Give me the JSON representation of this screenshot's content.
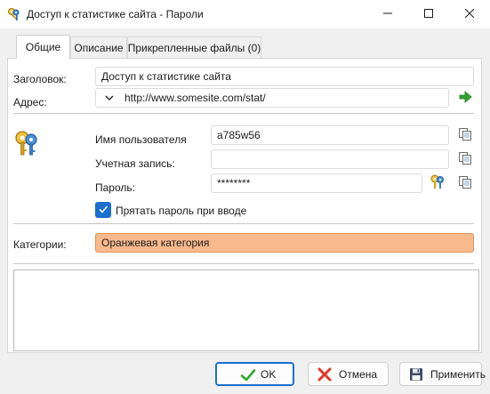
{
  "window": {
    "title": "Доступ к статистике сайта - Пароли",
    "controls": {
      "minimize": "minimize-icon",
      "maximize": "maximize-icon",
      "close": "close-icon"
    }
  },
  "tabs": [
    {
      "label": "Общие",
      "selected": true
    },
    {
      "label": "Описание",
      "selected": false
    },
    {
      "label": "Прикрепленные файлы (0)",
      "selected": false
    }
  ],
  "form": {
    "title_label": "Заголовок:",
    "title_value": "Доступ к статистике сайта",
    "address_label": "Адрес:",
    "address_value": "http://www.somesite.com/stat/",
    "username_label": "Имя пользователя",
    "username_value": "a785w56",
    "account_label": "Учетная запись:",
    "account_value": "",
    "password_label": "Пароль:",
    "password_value": "********",
    "hide_password_label": "Прятать пароль при вводе",
    "hide_password_checked": true,
    "category_label": "Категории:",
    "category_value": "Оранжевая категория",
    "notes_value": ""
  },
  "buttons": {
    "ok": "OK",
    "cancel": "Отмена",
    "apply": "Применить"
  },
  "colors": {
    "category_bg": "#f8b98d",
    "category_border": "#e3935a",
    "accent": "#1a6fd0",
    "go_arrow": "#2fa52f",
    "cancel_x": "#e2362b"
  }
}
